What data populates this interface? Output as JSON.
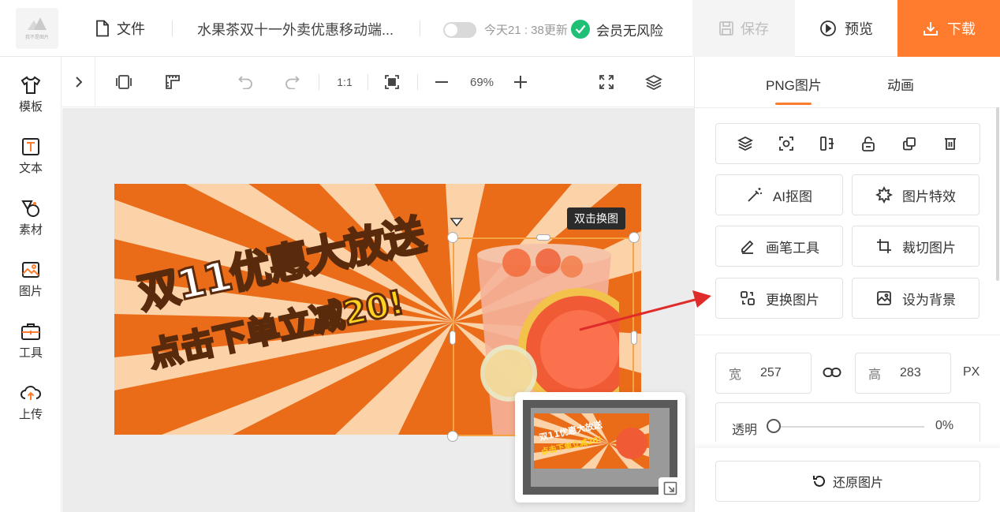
{
  "header": {
    "logo_caption": "我不是图片",
    "file_label": "文件",
    "doc_title": "水果茶双十一外卖优惠移动端...",
    "update_status": "今天21 : 38更新",
    "member_status": "会员无风险",
    "save_label": "保存",
    "preview_label": "预览",
    "download_label": "下载",
    "colors": {
      "accent": "#ff7b2e",
      "success": "#1fbf75"
    }
  },
  "sidebar": {
    "items": [
      {
        "label": "模板",
        "icon": "tshirt-icon"
      },
      {
        "label": "文本",
        "icon": "text-icon"
      },
      {
        "label": "素材",
        "icon": "shapes-icon"
      },
      {
        "label": "图片",
        "icon": "image-icon"
      },
      {
        "label": "工具",
        "icon": "toolbox-icon"
      },
      {
        "label": "上传",
        "icon": "cloud-upload-icon"
      }
    ]
  },
  "toolbar": {
    "ratio_label": "1:1",
    "zoom_value": "69%"
  },
  "canvas": {
    "hint_label": "双击换图",
    "banner_line1": "双11优惠大放送",
    "banner_line2": "点击下单立减20!",
    "minimap_line1": "双11优惠大放送",
    "minimap_line2": "点击下单立减20!"
  },
  "panel": {
    "tabs": [
      {
        "label": "PNG图片"
      },
      {
        "label": "动画"
      }
    ],
    "actions": {
      "ai_cutout": "AI抠图",
      "effects": "图片特效",
      "brush": "画笔工具",
      "crop": "裁切图片",
      "replace": "更换图片",
      "set_bg": "设为背景"
    },
    "width_key": "宽",
    "width_value": "257",
    "height_key": "高",
    "height_value": "283",
    "unit": "PX",
    "opacity_label": "透明",
    "opacity_value": "0%",
    "restore_label": "还原图片"
  }
}
